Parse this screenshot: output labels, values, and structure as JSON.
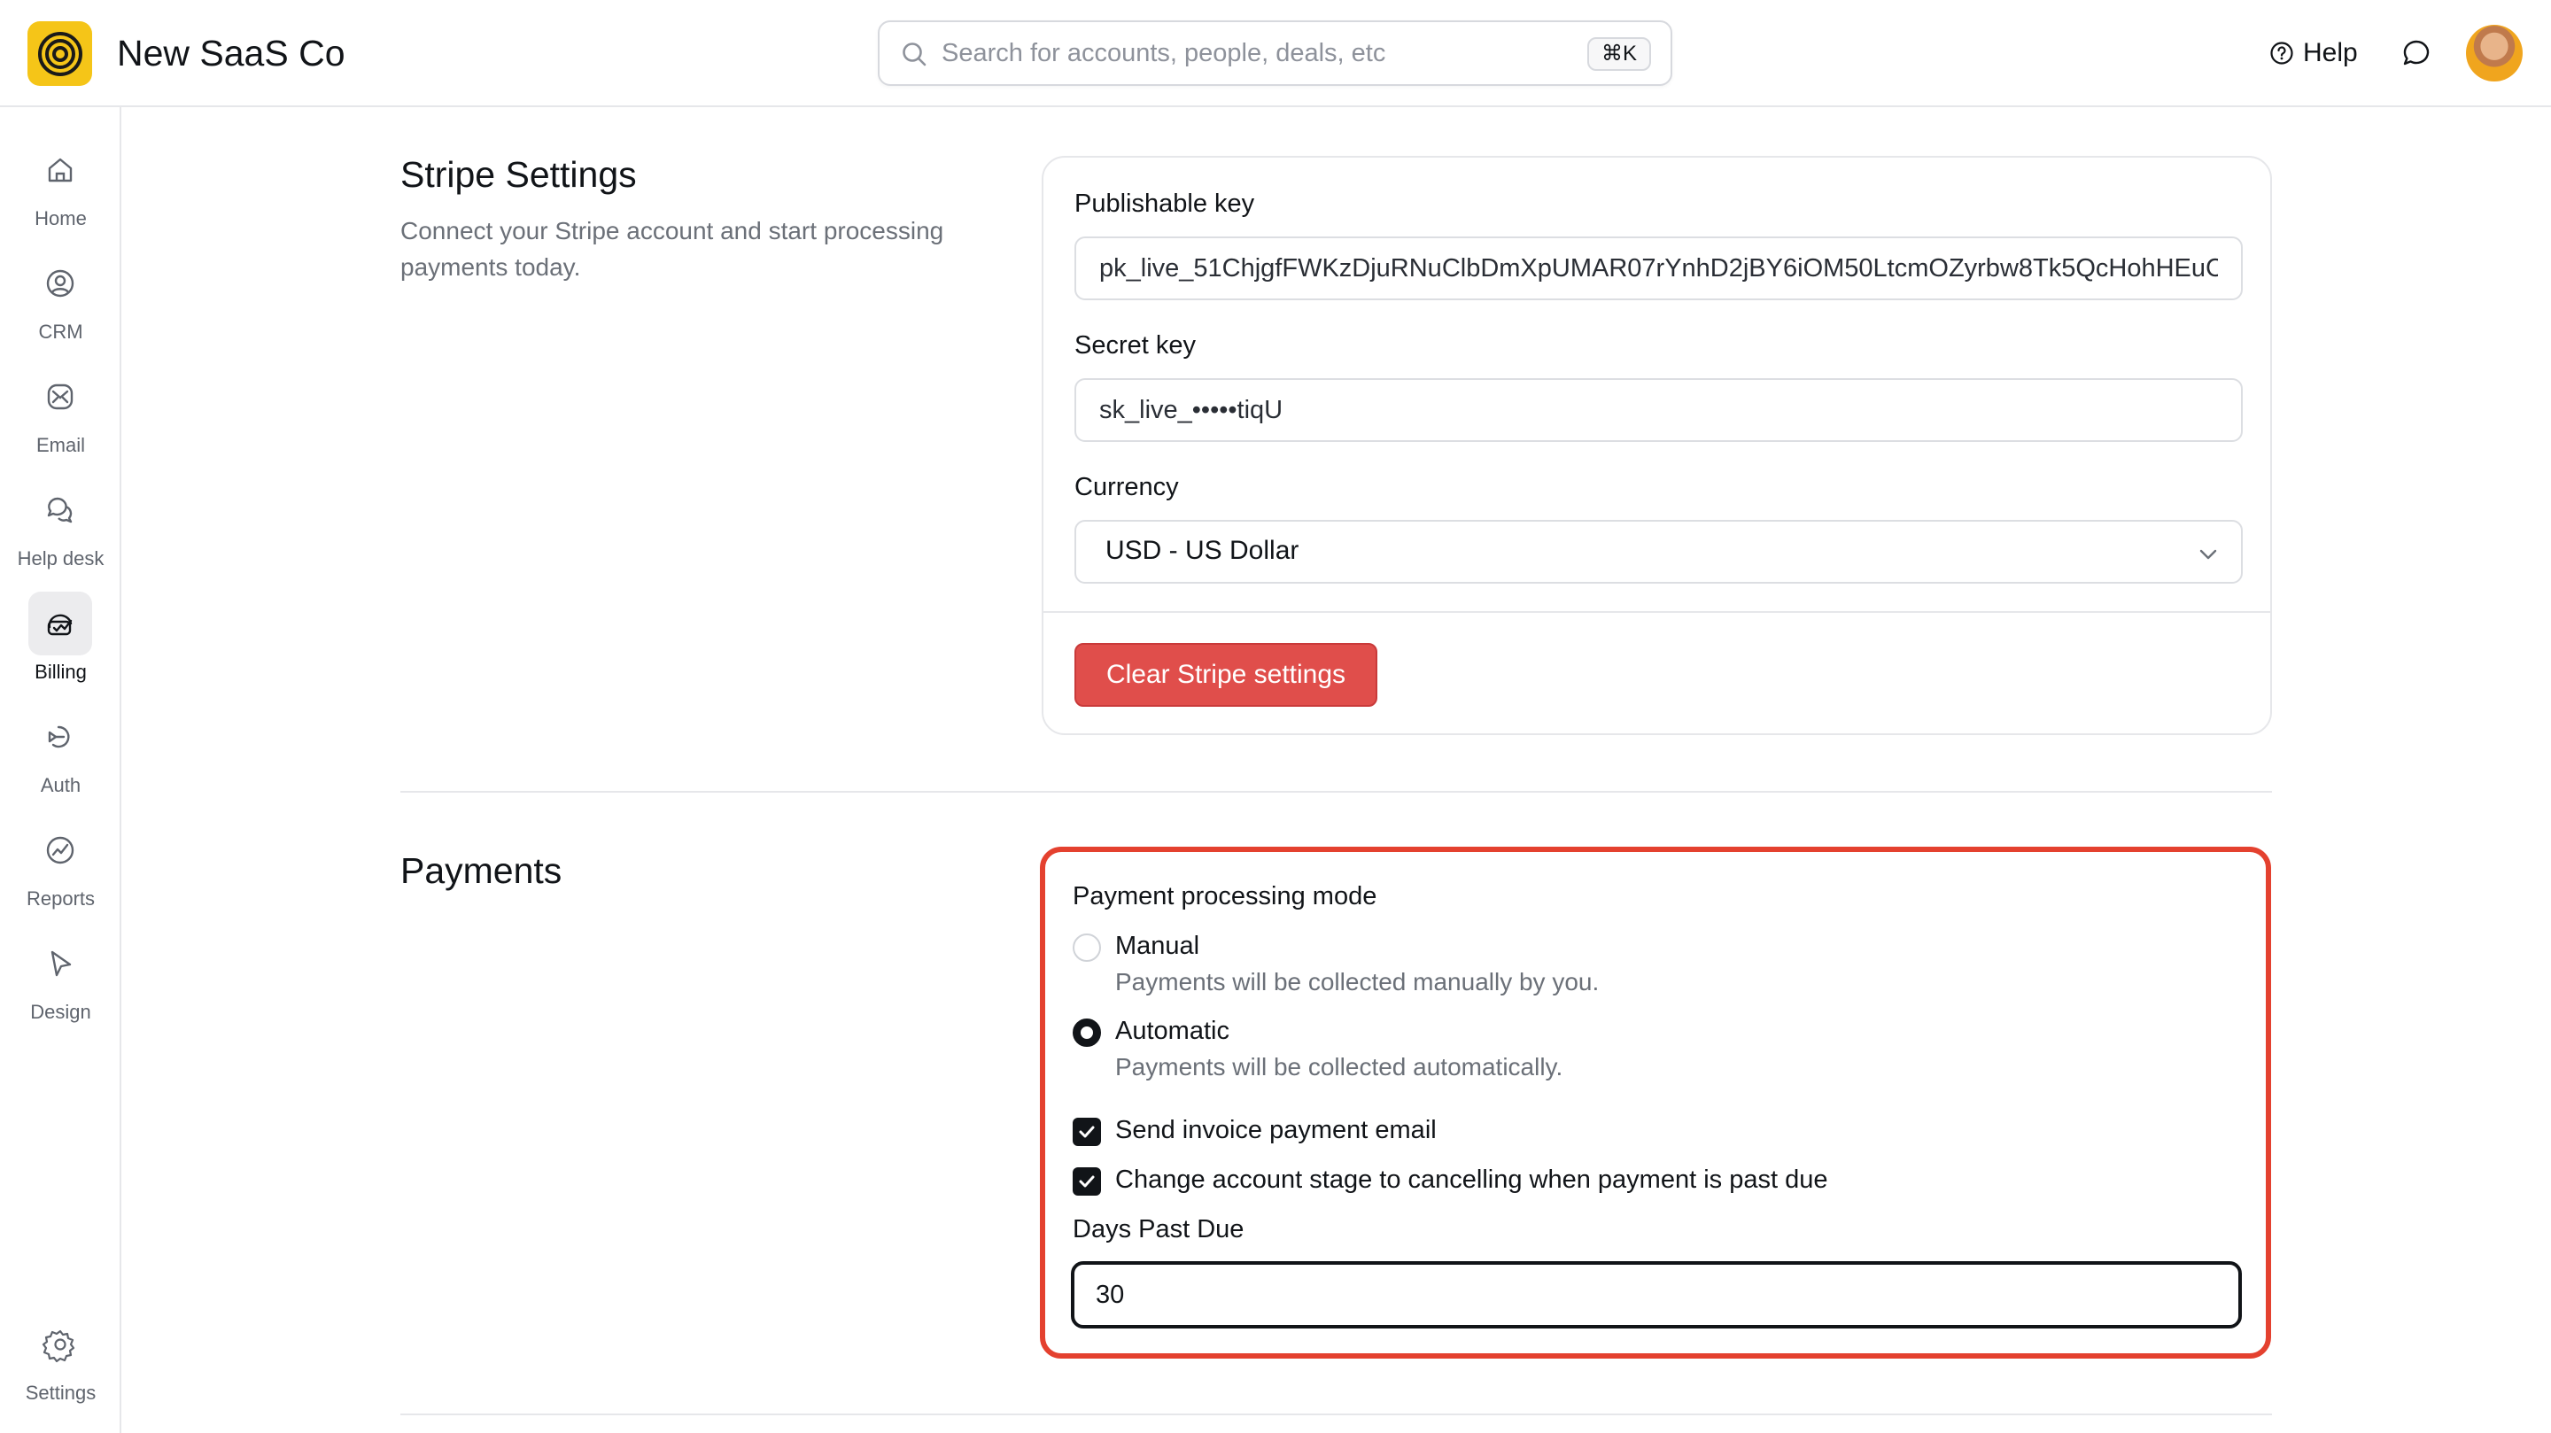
{
  "app": {
    "name": "New SaaS Co"
  },
  "search": {
    "placeholder": "Search for accounts, people, deals, etc",
    "shortcut": "⌘K"
  },
  "header": {
    "help_label": "Help"
  },
  "sidebar": {
    "items": [
      {
        "label": "Home",
        "icon": "home-icon"
      },
      {
        "label": "CRM",
        "icon": "user-circle-icon"
      },
      {
        "label": "Email",
        "icon": "mail-icon"
      },
      {
        "label": "Help desk",
        "icon": "chat-bubbles-icon"
      },
      {
        "label": "Billing",
        "icon": "billing-icon",
        "active": true
      },
      {
        "label": "Auth",
        "icon": "auth-icon"
      },
      {
        "label": "Reports",
        "icon": "chart-icon"
      },
      {
        "label": "Design",
        "icon": "cursor-icon"
      }
    ],
    "settings_label": "Settings"
  },
  "stripe": {
    "title": "Stripe Settings",
    "subtitle_line1": "Connect your Stripe account and start processing",
    "subtitle_line2": "payments today.",
    "publishable_label": "Publishable key",
    "publishable_value": "pk_live_51ChjgfFWKzDjuRNuClbDmXpUMAR07rYnhD2jBY6iOM50LtcmOZyrbw8Tk5QcHohHEuC",
    "secret_label": "Secret key",
    "secret_value": "sk_live_•••••tiqU",
    "currency_label": "Currency",
    "currency_value": "USD - US Dollar",
    "clear_button": "Clear Stripe settings"
  },
  "payments": {
    "title": "Payments",
    "mode_label": "Payment processing mode",
    "manual_title": "Manual",
    "manual_desc": "Payments will be collected manually by you.",
    "automatic_title": "Automatic",
    "automatic_desc": "Payments will be collected automatically.",
    "selected_mode": "Automatic",
    "send_invoice_label": "Send invoice payment email",
    "send_invoice_checked": true,
    "change_stage_label": "Change account stage to cancelling when payment is past due",
    "change_stage_checked": true,
    "days_label": "Days Past Due",
    "days_value": "30"
  },
  "colors": {
    "accent": "#111418",
    "danger": "#e04e4b",
    "highlight": "#e4412f",
    "logo": "#f5c518"
  }
}
